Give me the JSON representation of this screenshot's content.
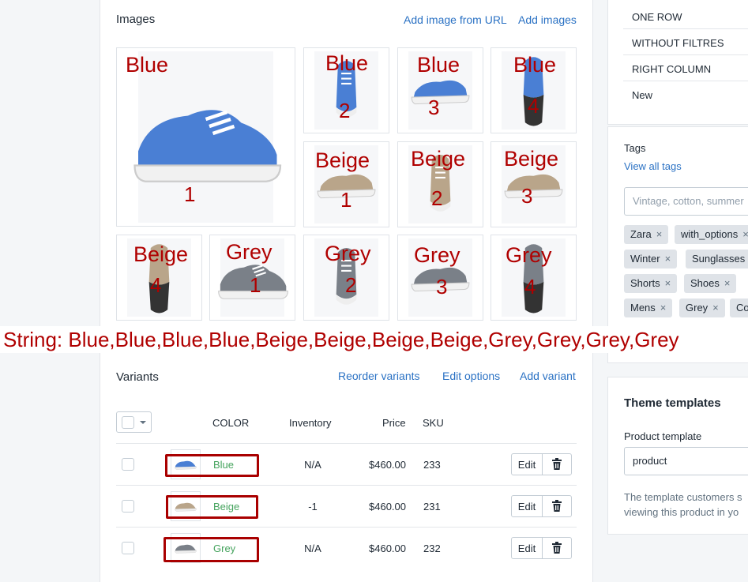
{
  "images_section": {
    "title": "Images",
    "add_from_url": "Add image from URL",
    "add_images": "Add images",
    "overlays": [
      {
        "label": "Blue",
        "num": "1"
      },
      {
        "label": "Blue",
        "num": "2"
      },
      {
        "label": "Blue",
        "num": "3"
      },
      {
        "label": "Blue",
        "num": "4"
      },
      {
        "label": "Beige",
        "num": "1"
      },
      {
        "label": "Beige",
        "num": "2"
      },
      {
        "label": "Beige",
        "num": "3"
      },
      {
        "label": "Beige",
        "num": "4"
      },
      {
        "label": "Grey",
        "num": "1"
      },
      {
        "label": "Grey",
        "num": "2"
      },
      {
        "label": "Grey",
        "num": "3"
      },
      {
        "label": "Grey",
        "num": "4"
      }
    ]
  },
  "annotation": "String: Blue,Blue,Blue,Blue,Beige,Beige,Beige,Beige,Grey,Grey,Grey,Grey",
  "variants": {
    "title": "Variants",
    "reorder": "Reorder variants",
    "edit_options": "Edit options",
    "add_variant": "Add variant",
    "headers": {
      "color": "COLOR",
      "inventory": "Inventory",
      "price": "Price",
      "sku": "SKU"
    },
    "rows": [
      {
        "color": "Blue",
        "inventory": "N/A",
        "price": "$460.00",
        "sku": "233",
        "edit": "Edit"
      },
      {
        "color": "Beige",
        "inventory": "-1",
        "price": "$460.00",
        "sku": "231",
        "edit": "Edit"
      },
      {
        "color": "Grey",
        "inventory": "N/A",
        "price": "$460.00",
        "sku": "232",
        "edit": "Edit"
      }
    ]
  },
  "sidebar": {
    "collections": [
      "ONE ROW",
      "WITHOUT FILTRES",
      "RIGHT COLUMN",
      "New"
    ],
    "tags_title": "Tags",
    "view_all_tags": "View all tags",
    "tags_placeholder": "Vintage, cotton, summer",
    "tags": [
      "Zara",
      "with_options",
      "Winter",
      "Sunglasses",
      "Shorts",
      "Shoes",
      "Mens",
      "Grey",
      "Co"
    ],
    "theme_title": "Theme templates",
    "product_template_label": "Product template",
    "product_template_value": "product",
    "theme_note_1": "The template customers s",
    "theme_note_2": "viewing this product in yo"
  },
  "colors": {
    "blue": "#4a7fd4",
    "beige": "#b9a58a",
    "grey": "#7a8088",
    "annotation_red": "#b00000",
    "link": "#2b72c4",
    "variant_green": "#45a35d"
  }
}
